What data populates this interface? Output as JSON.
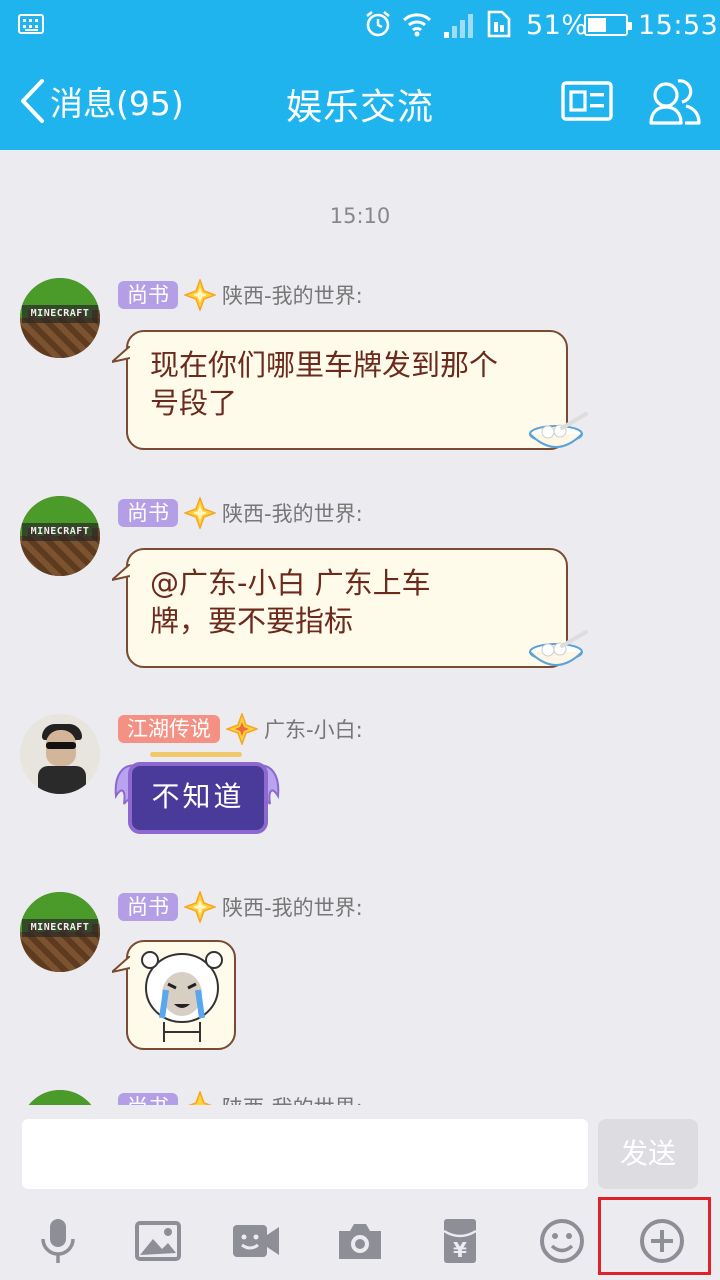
{
  "status_bar": {
    "battery": "51%",
    "time": "15:53",
    "battery_level": 0.51
  },
  "header": {
    "back_label": "消息(95)",
    "title": "娱乐交流"
  },
  "chat": {
    "time_divider": "15:10",
    "messages": [
      {
        "badge": "尚书",
        "nick": "陕西-我的世界:",
        "text_line1": "现在你们哪里车牌发到那个",
        "text_line2": "号段了"
      },
      {
        "badge": "尚书",
        "nick": "陕西-我的世界:",
        "text_line1": "@广东-小白 广东上车",
        "text_line2": "牌，要不要指标"
      },
      {
        "badge": "江湖传说",
        "nick": "广东-小白:",
        "sticker_text": "不知道"
      },
      {
        "badge": "尚书",
        "nick": "陕西-我的世界:"
      },
      {
        "badge": "尚书",
        "nick": "陕西-我的世界:"
      }
    ]
  },
  "input": {
    "placeholder": "",
    "send_label": "发送"
  },
  "toolbar": [
    "microphone-icon",
    "image-icon",
    "video-call-icon",
    "camera-icon",
    "red-packet-icon",
    "emoji-icon",
    "plus-icon"
  ],
  "colors": {
    "brand": "#20b4ee",
    "badge_purple": "#b49ee6",
    "badge_salmon": "#f49184",
    "highlight": "#e0202a"
  }
}
